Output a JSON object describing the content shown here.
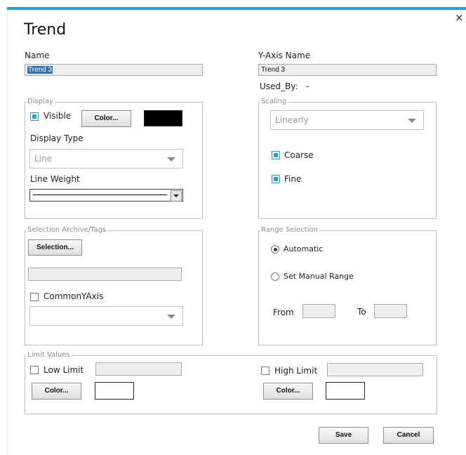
{
  "dialog": {
    "title": "Trend",
    "close_glyph": "×"
  },
  "name": {
    "label": "Name",
    "value": "Trend 3"
  },
  "yaxis": {
    "label": "Y-Axis Name",
    "value": "Trend 3",
    "used_by_label": "Used_By:",
    "used_by_value": "-"
  },
  "display": {
    "legend": "Display",
    "visible_label": "Visible",
    "visible_checked": true,
    "color_button": "Color...",
    "color_value": "#000000",
    "display_type_label": "Display Type",
    "display_type_value": "Line",
    "line_weight_label": "Line Weight"
  },
  "scaling": {
    "legend": "Scaling",
    "mode_value": "Linearly",
    "coarse_label": "Coarse",
    "coarse_checked": true,
    "fine_label": "Fine",
    "fine_checked": true
  },
  "selection": {
    "legend": "Selection Archive/Tags",
    "button": "Selection...",
    "path_value": "",
    "common_y_label": "CommonYAxis",
    "common_y_checked": false,
    "axis_value": ""
  },
  "range": {
    "legend": "Range Selection",
    "automatic_label": "Automatic",
    "automatic_selected": true,
    "manual_label": "Set Manual Range",
    "from_label": "From",
    "to_label": "To",
    "from_value": "",
    "to_value": ""
  },
  "limits": {
    "legend": "Limit Values",
    "low_label": "Low Limit",
    "low_value": "",
    "low_color_button": "Color...",
    "low_color": "#ffffff",
    "high_label": "High Limit",
    "high_value": "",
    "high_color_button": "Color...",
    "high_color": "#ffffff"
  },
  "footer": {
    "save": "Save",
    "cancel": "Cancel"
  },
  "colors": {
    "accent": "#1ba1e2",
    "border": "#bdbdbd"
  }
}
